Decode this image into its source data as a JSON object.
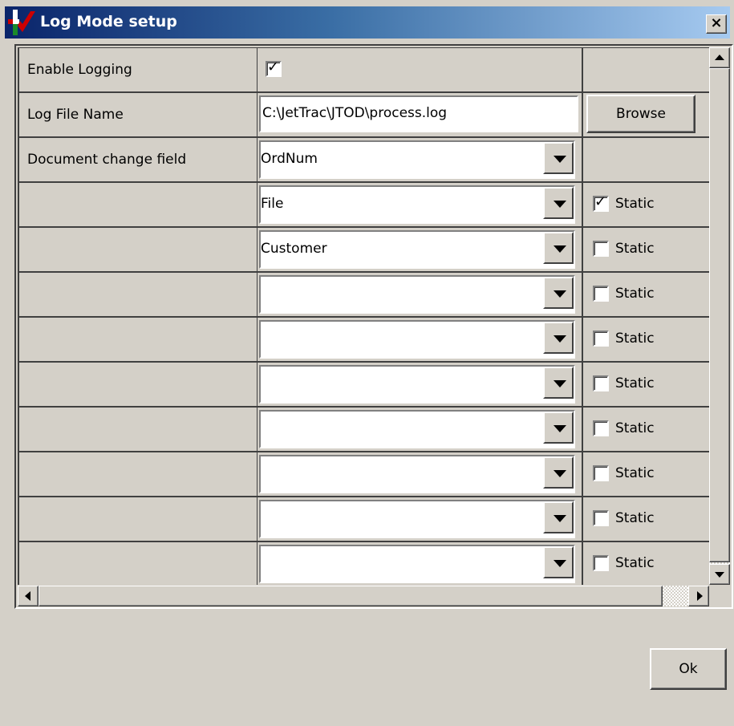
{
  "window": {
    "title": "Log Mode setup",
    "close_label": "×"
  },
  "settings": {
    "enable_logging_label": "Enable Logging",
    "enable_logging_checked": true,
    "log_file_name_label": "Log File Name",
    "log_file_name_value": "C:\\JetTrac\\JTOD\\process.log",
    "browse_label": "Browse",
    "doc_change_label": "Document change field",
    "doc_change_value": "OrdNum"
  },
  "fields": [
    {
      "value": "File",
      "static_label": "Static",
      "static_checked": true
    },
    {
      "value": "Customer",
      "static_label": "Static",
      "static_checked": false
    },
    {
      "value": "",
      "static_label": "Static",
      "static_checked": false
    },
    {
      "value": "",
      "static_label": "Static",
      "static_checked": false
    },
    {
      "value": "",
      "static_label": "Static",
      "static_checked": false
    },
    {
      "value": "",
      "static_label": "Static",
      "static_checked": false
    },
    {
      "value": "",
      "static_label": "Static",
      "static_checked": false
    },
    {
      "value": "",
      "static_label": "Static",
      "static_checked": false
    },
    {
      "value": "",
      "static_label": "Static",
      "static_checked": false
    },
    {
      "value": "",
      "static_label": "Static",
      "static_checked": false
    }
  ],
  "footer": {
    "ok_label": "Ok"
  },
  "icons": {
    "app": "jettrac-logo-icon",
    "check": "checkmark-icon"
  },
  "colors": {
    "title_start": "#0a246a",
    "title_end": "#a6caf0",
    "face": "#d4d0c8"
  }
}
